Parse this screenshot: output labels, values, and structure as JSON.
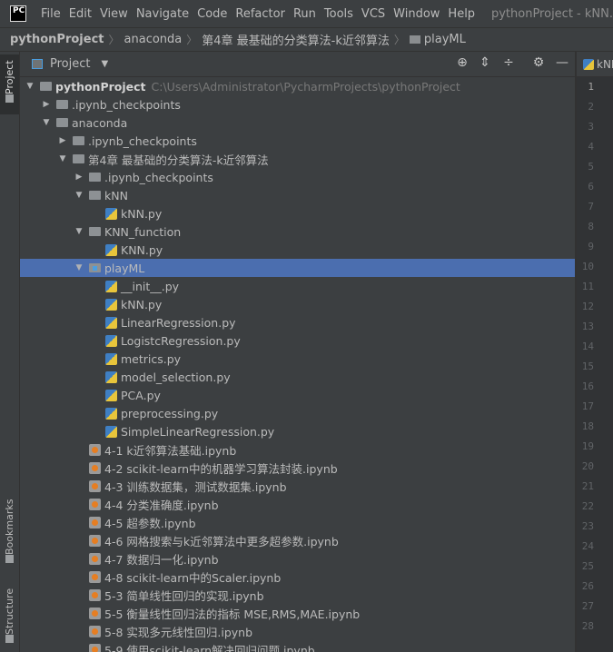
{
  "menubar": {
    "logo_text": "PC",
    "items": [
      "File",
      "Edit",
      "View",
      "Navigate",
      "Code",
      "Refactor",
      "Run",
      "Tools",
      "VCS",
      "Window",
      "Help"
    ],
    "window_title": "pythonProject - kNN."
  },
  "breadcrumbs": [
    "pythonProject",
    "anaconda",
    "第4章 最基础的分类算法-k近邻算法",
    "playML"
  ],
  "left_strip": {
    "project_tab": "Project",
    "bookmarks_tab": "Bookmarks",
    "structure_tab": "Structure"
  },
  "panel": {
    "title": "Project"
  },
  "tree": [
    {
      "label": "pythonProject",
      "path": "C:\\Users\\Administrator\\PycharmProjects\\pythonProject",
      "icon": "folder-icon",
      "expanded": true,
      "level": 0,
      "bold": true
    },
    {
      "label": ".ipynb_checkpoints",
      "icon": "folder-icon",
      "expanded": false,
      "level": 1
    },
    {
      "label": "anaconda",
      "icon": "folder-icon",
      "expanded": true,
      "level": 1
    },
    {
      "label": ".ipynb_checkpoints",
      "icon": "folder-icon",
      "expanded": false,
      "level": 2
    },
    {
      "label": "第4章 最基础的分类算法-k近邻算法",
      "icon": "folder-icon",
      "expanded": true,
      "level": 2
    },
    {
      "label": ".ipynb_checkpoints",
      "icon": "folder-icon",
      "expanded": false,
      "level": 3
    },
    {
      "label": "kNN",
      "icon": "folder-icon",
      "expanded": true,
      "level": 3
    },
    {
      "label": "kNN.py",
      "icon": "python-file-icon",
      "level": 4
    },
    {
      "label": "KNN_function",
      "icon": "folder-icon",
      "expanded": true,
      "level": 3
    },
    {
      "label": "KNN.py",
      "icon": "python-file-icon",
      "level": 4
    },
    {
      "label": "playML",
      "icon": "package-folder-icon",
      "expanded": true,
      "level": 3,
      "selected": true
    },
    {
      "label": "__init__.py",
      "icon": "python-file-icon",
      "level": 4
    },
    {
      "label": "kNN.py",
      "icon": "python-file-icon",
      "level": 4
    },
    {
      "label": "LinearRegression.py",
      "icon": "python-file-icon",
      "level": 4
    },
    {
      "label": "LogistcRegression.py",
      "icon": "python-file-icon",
      "level": 4
    },
    {
      "label": "metrics.py",
      "icon": "python-file-icon",
      "level": 4
    },
    {
      "label": "model_selection.py",
      "icon": "python-file-icon",
      "level": 4
    },
    {
      "label": "PCA.py",
      "icon": "python-file-icon",
      "level": 4
    },
    {
      "label": "preprocessing.py",
      "icon": "python-file-icon",
      "level": 4
    },
    {
      "label": "SimpleLinearRegression.py",
      "icon": "python-file-icon",
      "level": 4
    },
    {
      "label": "4-1 k近邻算法基础.ipynb",
      "icon": "notebook-file-icon",
      "level": 3
    },
    {
      "label": "4-2 scikit-learn中的机器学习算法封装.ipynb",
      "icon": "notebook-file-icon",
      "level": 3
    },
    {
      "label": "4-3 训练数据集，测试数据集.ipynb",
      "icon": "notebook-file-icon",
      "level": 3
    },
    {
      "label": "4-4 分类准确度.ipynb",
      "icon": "notebook-file-icon",
      "level": 3
    },
    {
      "label": "4-5 超参数.ipynb",
      "icon": "notebook-file-icon",
      "level": 3
    },
    {
      "label": "4-6 网格搜索与k近邻算法中更多超参数.ipynb",
      "icon": "notebook-file-icon",
      "level": 3
    },
    {
      "label": "4-7 数据归一化.ipynb",
      "icon": "notebook-file-icon",
      "level": 3
    },
    {
      "label": "4-8 scikit-learn中的Scaler.ipynb",
      "icon": "notebook-file-icon",
      "level": 3
    },
    {
      "label": "5-3 简单线性回归的实现.ipynb",
      "icon": "notebook-file-icon",
      "level": 3
    },
    {
      "label": "5-5 衡量线性回归法的指标 MSE,RMS,MAE.ipynb",
      "icon": "notebook-file-icon",
      "level": 3
    },
    {
      "label": "5-8 实现多元线性回归.ipynb",
      "icon": "notebook-file-icon",
      "level": 3
    },
    {
      "label": "5-9 使用scikit-learn解决回归问题.ipynb",
      "icon": "notebook-file-icon",
      "level": 3
    }
  ],
  "editor": {
    "tab_label": "kNN.",
    "line_numbers": [
      "1",
      "2",
      "3",
      "4",
      "5",
      "6",
      "7",
      "8",
      "9",
      "10",
      "11",
      "12",
      "13",
      "14",
      "15",
      "16",
      "17",
      "18",
      "19",
      "20",
      "21",
      "22",
      "23",
      "24",
      "25",
      "26",
      "27",
      "28"
    ],
    "current_line": "1"
  }
}
